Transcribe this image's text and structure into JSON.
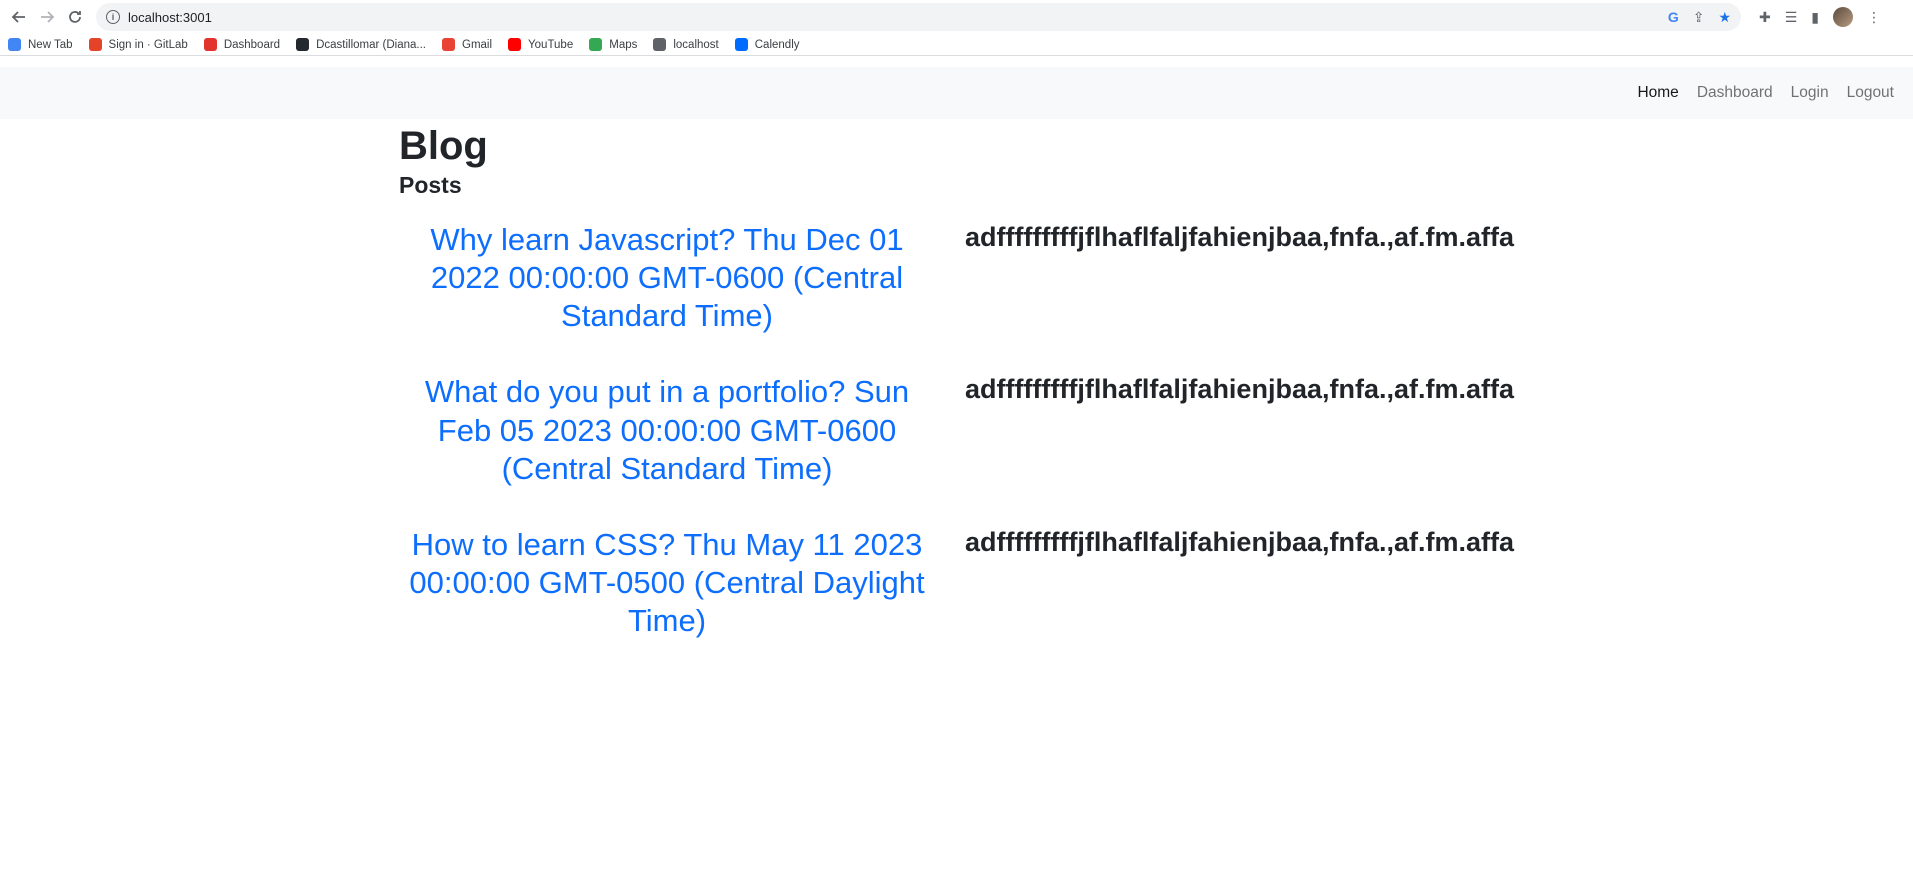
{
  "browser": {
    "url": "localhost:3001",
    "bookmarks": [
      {
        "label": "New Tab",
        "icon": "google-icon",
        "color": "#4285f4"
      },
      {
        "label": "Sign in · GitLab",
        "icon": "gitlab-icon",
        "color": "#e24329"
      },
      {
        "label": "Dashboard",
        "icon": "dashboard-icon",
        "color": "#e2332f"
      },
      {
        "label": "Dcastillomar (Diana...",
        "icon": "github-icon",
        "color": "#24292f"
      },
      {
        "label": "Gmail",
        "icon": "gmail-icon",
        "color": "#ea4335"
      },
      {
        "label": "YouTube",
        "icon": "youtube-icon",
        "color": "#ff0000"
      },
      {
        "label": "Maps",
        "icon": "maps-icon",
        "color": "#34a853"
      },
      {
        "label": "localhost",
        "icon": "globe-icon",
        "color": "#5f6368"
      },
      {
        "label": "Calendly",
        "icon": "calendly-icon",
        "color": "#006bff"
      }
    ]
  },
  "nav": {
    "home": "Home",
    "dashboard": "Dashboard",
    "login": "Login",
    "logout": "Logout"
  },
  "page": {
    "title": "Blog",
    "subtitle": "Posts"
  },
  "posts": [
    {
      "title": "Why learn Javascript? Thu Dec 01 2022 00:00:00 GMT-0600 (Central Standard Time)",
      "body": "adfffffffffjflhaflfaljfahienjbaa,fnfa.,af.fm.affa"
    },
    {
      "title": "What do you put in a portfolio? Sun Feb 05 2023 00:00:00 GMT-0600 (Central Standard Time)",
      "body": "adfffffffffjflhaflfaljfahienjbaa,fnfa.,af.fm.affa"
    },
    {
      "title": "How to learn CSS? Thu May 11 2023 00:00:00 GMT-0500 (Central Daylight Time)",
      "body": "adfffffffffjflhaflfaljfahienjbaa,fnfa.,af.fm.affa"
    }
  ],
  "colors": {
    "link": "#0d6efd",
    "navbar_bg": "#f8f9fa"
  }
}
